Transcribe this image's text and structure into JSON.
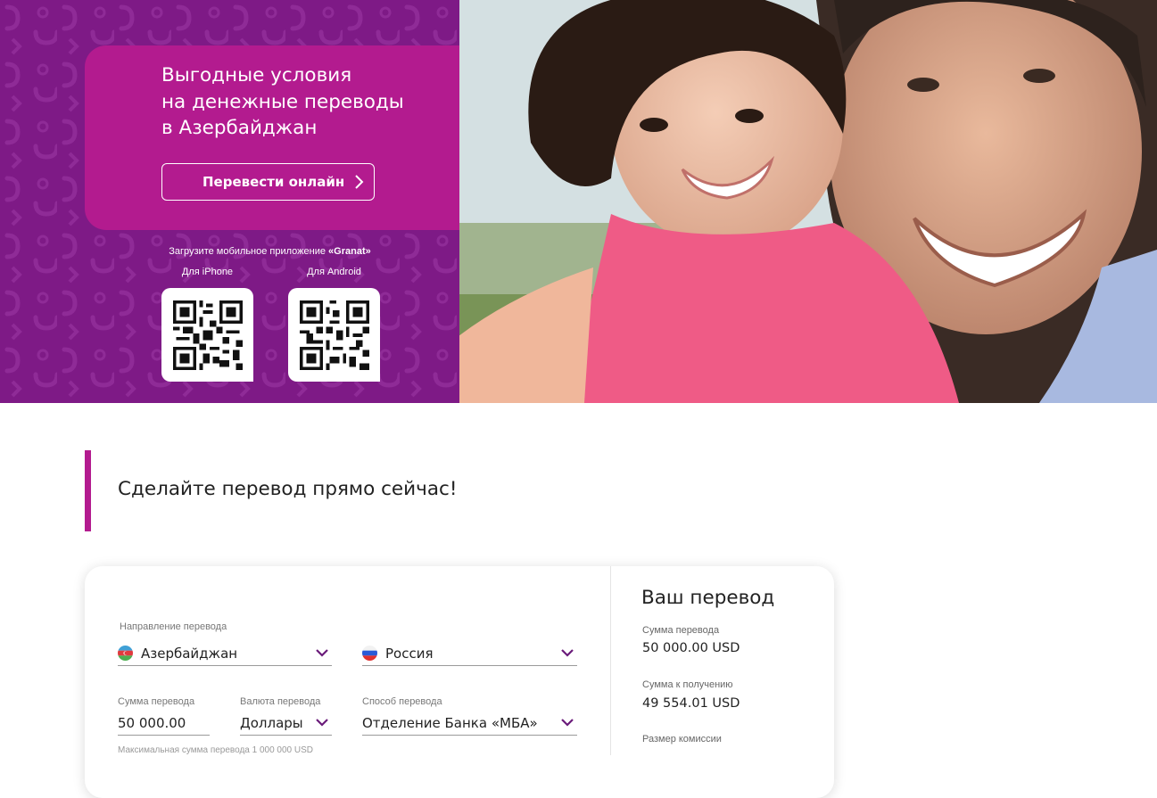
{
  "hero": {
    "title": "Выгодные условия\nна денежные переводы\nв Азербайджан",
    "cta_label": "Перевести онлайн",
    "app_caption_prefix": "Загрузите мобильное приложение ",
    "app_name": "«Granat»",
    "iphone_label": "Для iPhone",
    "android_label": "Для Android",
    "colors": {
      "pattern": "#7e1a86",
      "promo_box": "#b31b8f"
    }
  },
  "section": {
    "title": "Сделайте перевод прямо сейчас!"
  },
  "form": {
    "direction_label": "Направление перевода",
    "from_country": "Азербайджан",
    "to_country": "Россия",
    "amount_label": "Сумма перевода",
    "amount_value": "50 000.00",
    "amount_hint": "Максимальная сумма перевода 1 000 000 USD",
    "currency_label": "Валюта перевода",
    "currency_value": "Доллары",
    "method_label": "Способ перевода",
    "method_value": "Отделение Банка «МБА»"
  },
  "summary": {
    "title": "Ваш перевод",
    "transfer_amount_label": "Сумма перевода",
    "transfer_amount_value": "50 000.00 USD",
    "receive_amount_label": "Сумма к получению",
    "receive_amount_value": "49 554.01 USD",
    "commission_label": "Размер комиссии"
  }
}
